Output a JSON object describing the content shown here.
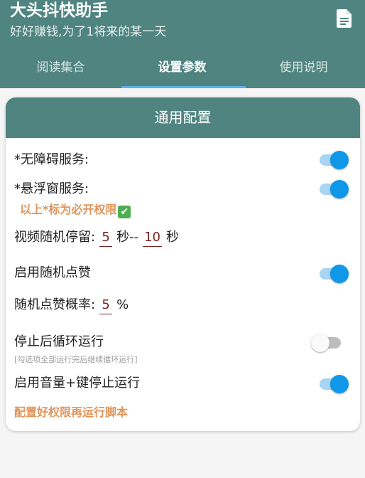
{
  "app": {
    "title": "大头抖快助手",
    "subtitle": "好好赚钱,为了1将来的某一天",
    "doc_icon": "document-icon"
  },
  "tabs": [
    {
      "label": "阅读集合",
      "active": false
    },
    {
      "label": "设置参数",
      "active": true
    },
    {
      "label": "使用说明",
      "active": false
    }
  ],
  "card": {
    "title": "通用配置",
    "accessibility_label": "*无障碍服务:",
    "accessibility_on": true,
    "float_label": "*悬浮窗服务:",
    "float_on": true,
    "required_note": "以上*标为必开权限",
    "required_check": "✔",
    "stay_label": "视频随机停留:",
    "stay_min": "5",
    "stay_sep": "秒--",
    "stay_max": "10",
    "stay_unit": "秒",
    "random_like_label": "启用随机点赞",
    "random_like_on": true,
    "like_rate_label": "随机点赞概率:",
    "like_rate_value": "5",
    "like_rate_unit": "%",
    "loop_label": "停止后循环运行",
    "loop_on": false,
    "loop_hint": "[勾选项全部运行完后继续循环运行]",
    "volume_stop_label": "启用音量+键停止运行",
    "volume_stop_on": true,
    "footer_note": "配置好权限再运行脚本"
  },
  "colors": {
    "primary": "#4f8481",
    "switch_on": "#0f97e8",
    "accent_note": "#e0955a",
    "value_text": "#7a2323"
  }
}
